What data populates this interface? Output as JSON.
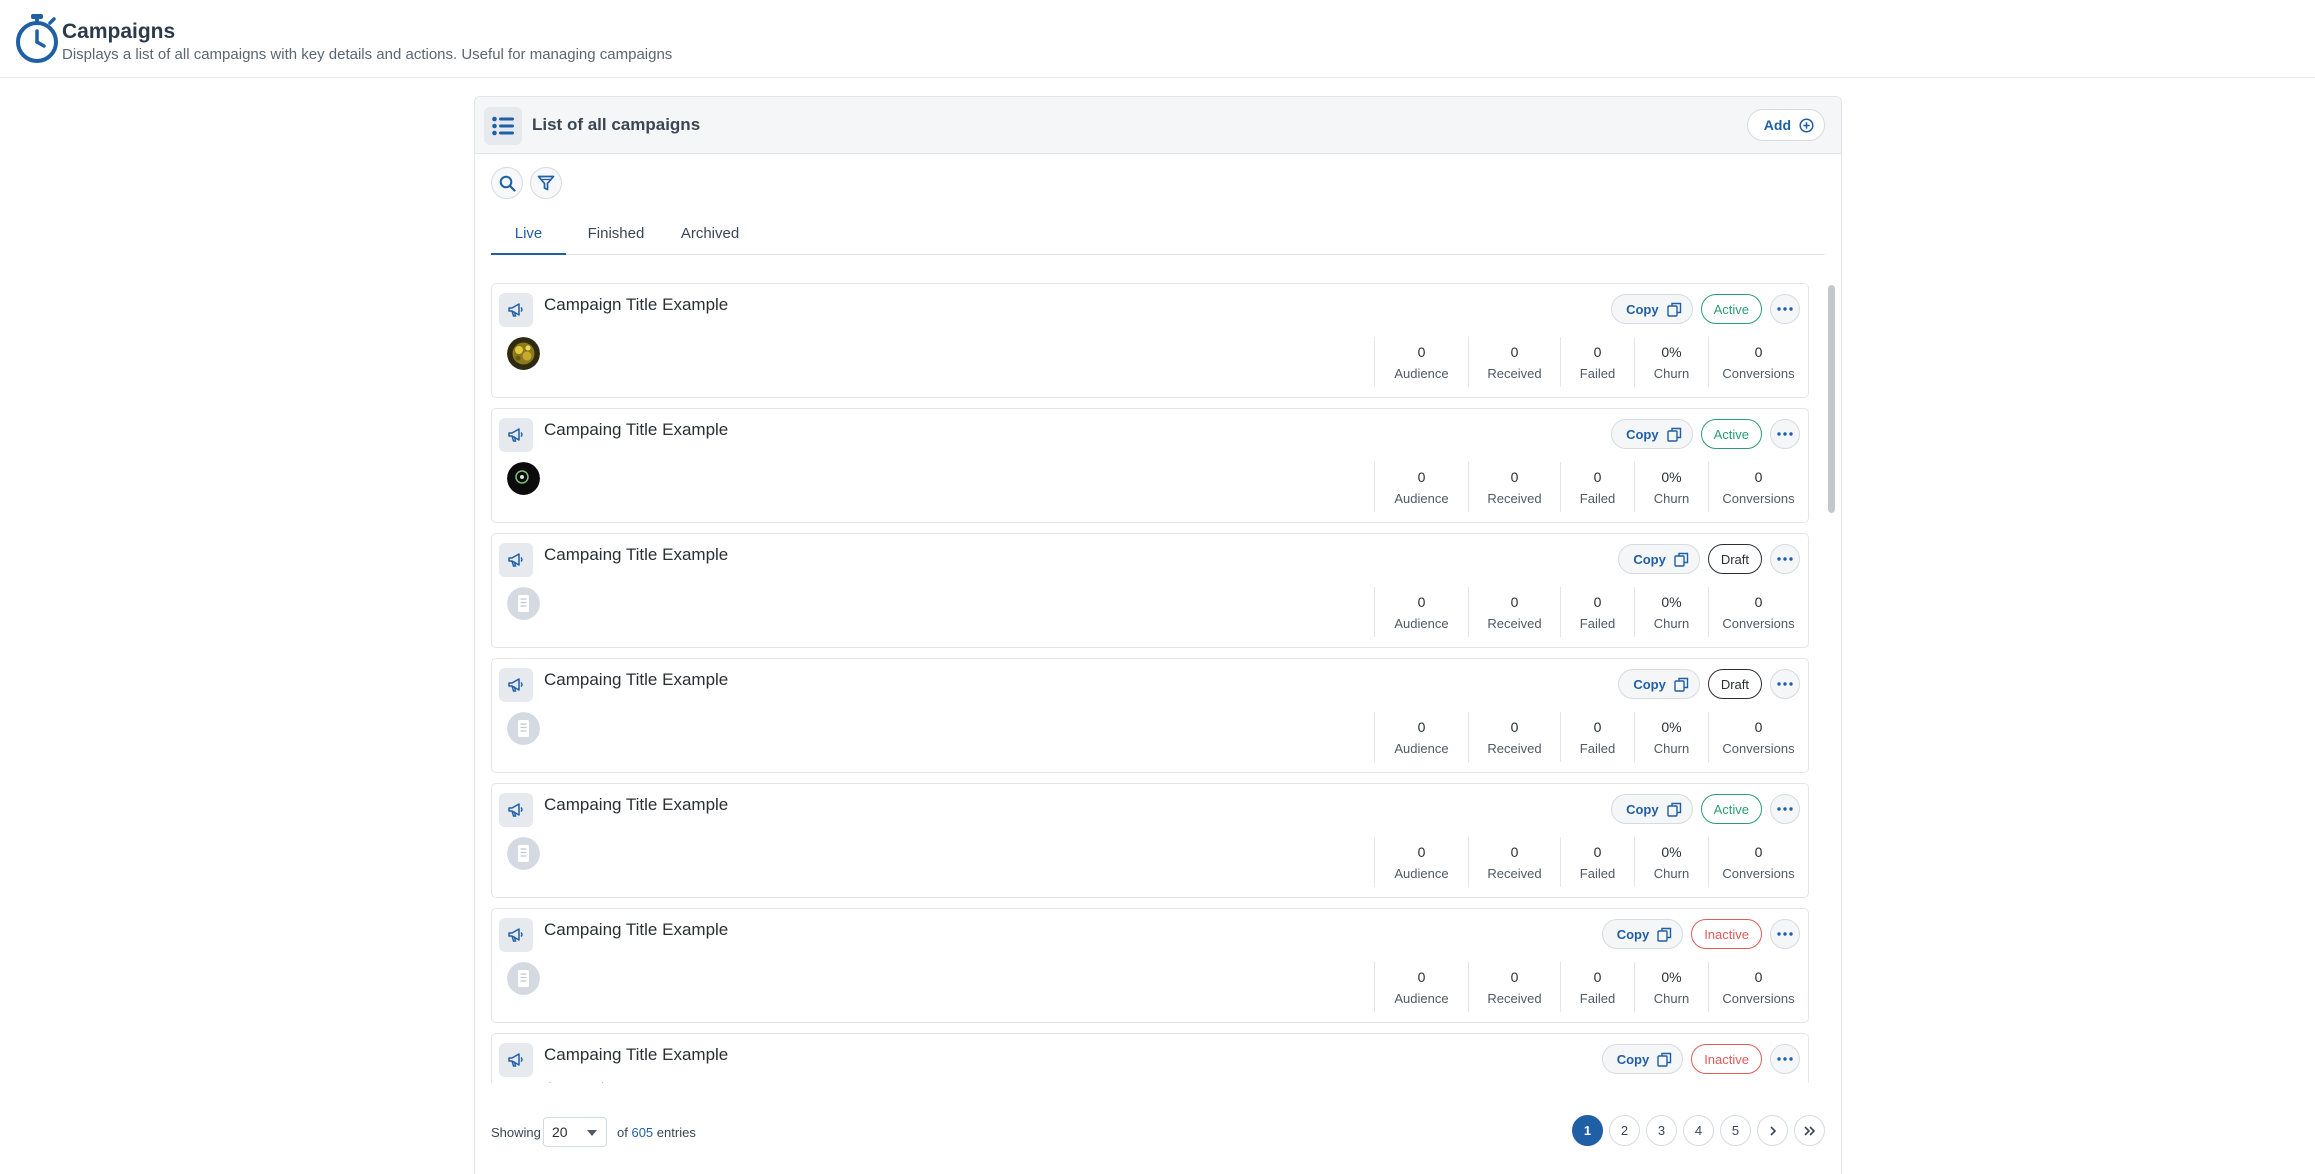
{
  "header": {
    "title": "Campaigns",
    "subtitle": "Displays a list of all campaigns with key details and actions. Useful for managing campaigns",
    "icon": "stopwatch-icon"
  },
  "card": {
    "title": "List of all campaigns",
    "add_label": "Add"
  },
  "tabs": [
    {
      "label": "Live",
      "active": true
    },
    {
      "label": "Finished",
      "active": false
    },
    {
      "label": "Archived",
      "active": false
    }
  ],
  "colors": {
    "accent": "#1f5fa5",
    "active": "#2a9d72",
    "draft": "#2b2f33",
    "inactive": "#e05a5a"
  },
  "copy_label": "Copy",
  "stat_labels": [
    "Audience",
    "Received",
    "Failed",
    "Churn",
    "Conversions"
  ],
  "campaigns": [
    {
      "title": "Campaign Title Example",
      "status": "Active",
      "avatar": "gold",
      "stats": [
        "0",
        "0",
        "0",
        "0%",
        "0"
      ],
      "sub": ""
    },
    {
      "title": "Campaing Title Example",
      "status": "Active",
      "avatar": "dark",
      "stats": [
        "0",
        "0",
        "0",
        "0%",
        "0"
      ],
      "sub": ""
    },
    {
      "title": "Campaing Title Example",
      "status": "Draft",
      "avatar": "placeholder",
      "stats": [
        "0",
        "0",
        "0",
        "0%",
        "0"
      ],
      "sub": ""
    },
    {
      "title": "Campaing Title Example",
      "status": "Draft",
      "avatar": "placeholder",
      "stats": [
        "0",
        "0",
        "0",
        "0%",
        "0"
      ],
      "sub": ""
    },
    {
      "title": "Campaing Title Example",
      "status": "Active",
      "avatar": "placeholder",
      "stats": [
        "0",
        "0",
        "0",
        "0%",
        "0"
      ],
      "sub": ""
    },
    {
      "title": "Campaing Title Example",
      "status": "Inactive",
      "avatar": "placeholder",
      "stats": [
        "0",
        "0",
        "0",
        "0%",
        "0"
      ],
      "sub": ""
    },
    {
      "title": "Campaing Title Example",
      "status": "Inactive",
      "avatar": "none",
      "stats": [],
      "sub": "dasas update"
    }
  ],
  "footer": {
    "showing_label": "Showing",
    "page_size": "20",
    "of_label": "of",
    "total": "605",
    "entries_label": "entries",
    "pages": [
      "1",
      "2",
      "3",
      "4",
      "5"
    ],
    "current_page": "1"
  }
}
